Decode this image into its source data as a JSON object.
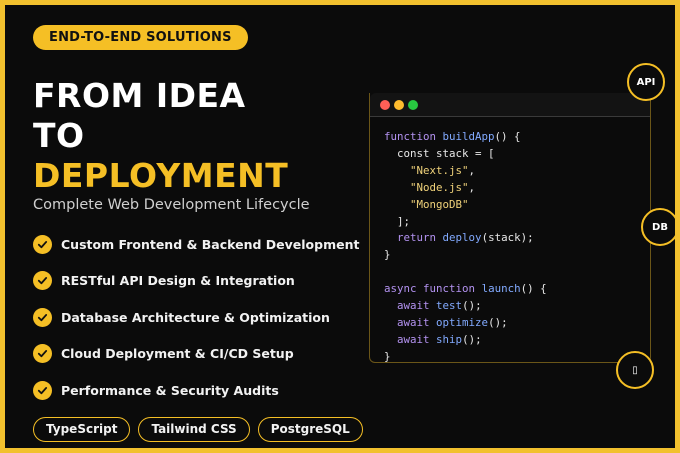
{
  "badge": "END-TO-END SOLUTIONS",
  "headline": [
    "FROM IDEA",
    "TO",
    "DEPLOYMENT"
  ],
  "subtitle": "Complete Web Development Lifecycle",
  "features": [
    "Custom Frontend & Backend Development",
    "RESTful API Design & Integration",
    "Database Architecture & Optimization",
    "Cloud Deployment & CI/CD Setup",
    "Performance & Security Audits"
  ],
  "tags": [
    "TypeScript",
    "Tailwind CSS",
    "PostgreSQL"
  ],
  "nodes": {
    "api": "API",
    "db": "DB",
    "bottom": "▯"
  },
  "code_lines": [
    "function buildApp() {",
    "  const stack = [",
    "    \"Next.js\",",
    "    \"Node.js\",",
    "    \"MongoDB\"",
    "  ];",
    "  return deploy(stack);",
    "}",
    "",
    "async function launch() {",
    "  await test();",
    "  await optimize();",
    "  await ship();",
    "}"
  ],
  "colors": {
    "accent": "#f5bf25",
    "background": "#0b0b0b",
    "window_red": "#ff5f57",
    "window_yellow": "#febc2e",
    "window_green": "#28c840"
  }
}
